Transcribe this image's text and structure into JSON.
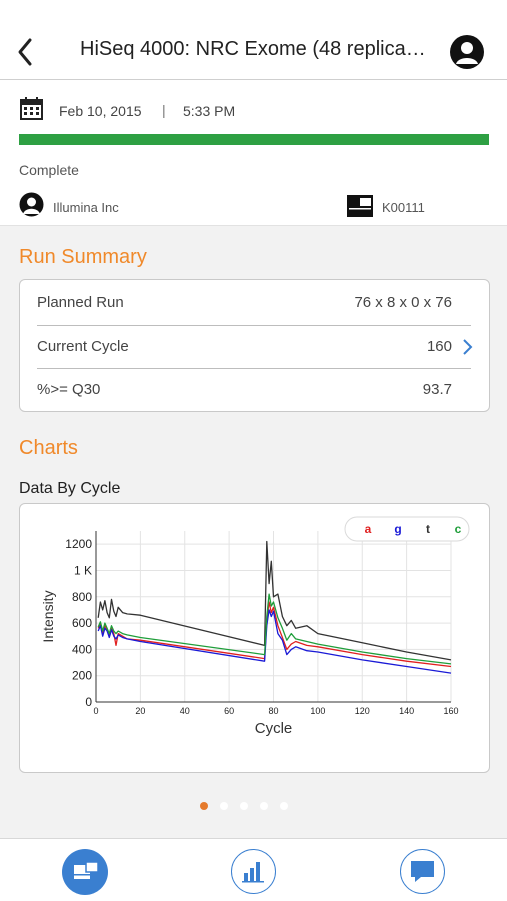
{
  "header": {
    "title": "HiSeq 4000: NRC Exome (48 replica…",
    "back_icon": "chevron-left-icon",
    "avatar_icon": "user-avatar-icon"
  },
  "run_info": {
    "date": "Feb 10, 2015",
    "separator": "|",
    "time": "5:33 PM",
    "progress_fraction": 1.0,
    "progress_color": "#2ea043",
    "status": "Complete",
    "owner": "Illumina Inc",
    "instrument": "K00111"
  },
  "run_summary": {
    "title": "Run Summary",
    "rows": [
      {
        "label": "Planned Run",
        "value": "76 x 8 x 0 x 76"
      },
      {
        "label": "Current Cycle",
        "value": "160"
      },
      {
        "label": "%>= Q30",
        "value": "93.7"
      }
    ]
  },
  "charts": {
    "title": "Charts",
    "subtitle": "Data By Cycle"
  },
  "chart_data": {
    "type": "line",
    "xlabel": "Cycle",
    "ylabel": "Intensity",
    "xlim": [
      0,
      160
    ],
    "ylim": [
      0,
      1300
    ],
    "xticks": [
      "0",
      "20",
      "40",
      "60",
      "80",
      "100",
      "120",
      "140",
      "160"
    ],
    "yticks": [
      {
        "v": 0,
        "label": "0"
      },
      {
        "v": 200,
        "label": "200"
      },
      {
        "v": 400,
        "label": "400"
      },
      {
        "v": 600,
        "label": "600"
      },
      {
        "v": 800,
        "label": "800"
      },
      {
        "v": 1000,
        "label": "1 K"
      },
      {
        "v": 1200,
        "label": "1200"
      }
    ],
    "grid": true,
    "legend_position": "top-right",
    "series": [
      {
        "name": "a",
        "color": "#e02020",
        "x": [
          1,
          2,
          3,
          4,
          5,
          6,
          7,
          8,
          9,
          10,
          12,
          14,
          20,
          76,
          77,
          78,
          79,
          80,
          82,
          84,
          86,
          88,
          90,
          95,
          100,
          120,
          140,
          160
        ],
        "y": [
          560,
          590,
          520,
          580,
          550,
          500,
          560,
          520,
          430,
          520,
          500,
          480,
          470,
          330,
          620,
          760,
          680,
          720,
          580,
          490,
          400,
          440,
          460,
          430,
          420,
          360,
          310,
          270
        ]
      },
      {
        "name": "g",
        "color": "#1a1ad6",
        "x": [
          1,
          2,
          3,
          4,
          5,
          6,
          7,
          8,
          9,
          10,
          12,
          14,
          20,
          76,
          77,
          78,
          79,
          80,
          82,
          84,
          86,
          88,
          90,
          95,
          100,
          120,
          140,
          160
        ],
        "y": [
          540,
          580,
          500,
          560,
          540,
          490,
          550,
          500,
          480,
          510,
          490,
          480,
          460,
          310,
          580,
          700,
          650,
          690,
          520,
          470,
          360,
          400,
          420,
          390,
          380,
          320,
          270,
          220
        ]
      },
      {
        "name": "t",
        "color": "#333333",
        "x": [
          1,
          2,
          3,
          4,
          5,
          6,
          7,
          8,
          9,
          10,
          12,
          14,
          20,
          76,
          77,
          78,
          79,
          80,
          82,
          84,
          86,
          88,
          90,
          95,
          100,
          120,
          140,
          160
        ],
        "y": [
          640,
          760,
          700,
          770,
          680,
          640,
          780,
          690,
          650,
          720,
          680,
          670,
          660,
          430,
          1220,
          900,
          1070,
          800,
          820,
          650,
          580,
          620,
          560,
          580,
          520,
          450,
          380,
          320
        ]
      },
      {
        "name": "c",
        "color": "#1f9e3a",
        "x": [
          1,
          2,
          3,
          4,
          5,
          6,
          7,
          8,
          9,
          10,
          12,
          14,
          20,
          76,
          77,
          78,
          79,
          80,
          82,
          84,
          86,
          88,
          90,
          95,
          100,
          120,
          140,
          160
        ],
        "y": [
          570,
          610,
          540,
          600,
          560,
          520,
          580,
          540,
          520,
          540,
          520,
          510,
          490,
          360,
          650,
          820,
          730,
          760,
          640,
          560,
          470,
          520,
          480,
          460,
          440,
          380,
          330,
          290
        ]
      }
    ]
  },
  "pager": {
    "count": 5,
    "active_index": 0,
    "active_color": "#e57a2c"
  },
  "tabbar": {
    "items": [
      {
        "icon": "runs-icon",
        "active": true
      },
      {
        "icon": "bar-chart-icon",
        "active": false
      },
      {
        "icon": "chat-icon",
        "active": false
      }
    ],
    "accent": "#3a7fd0"
  }
}
